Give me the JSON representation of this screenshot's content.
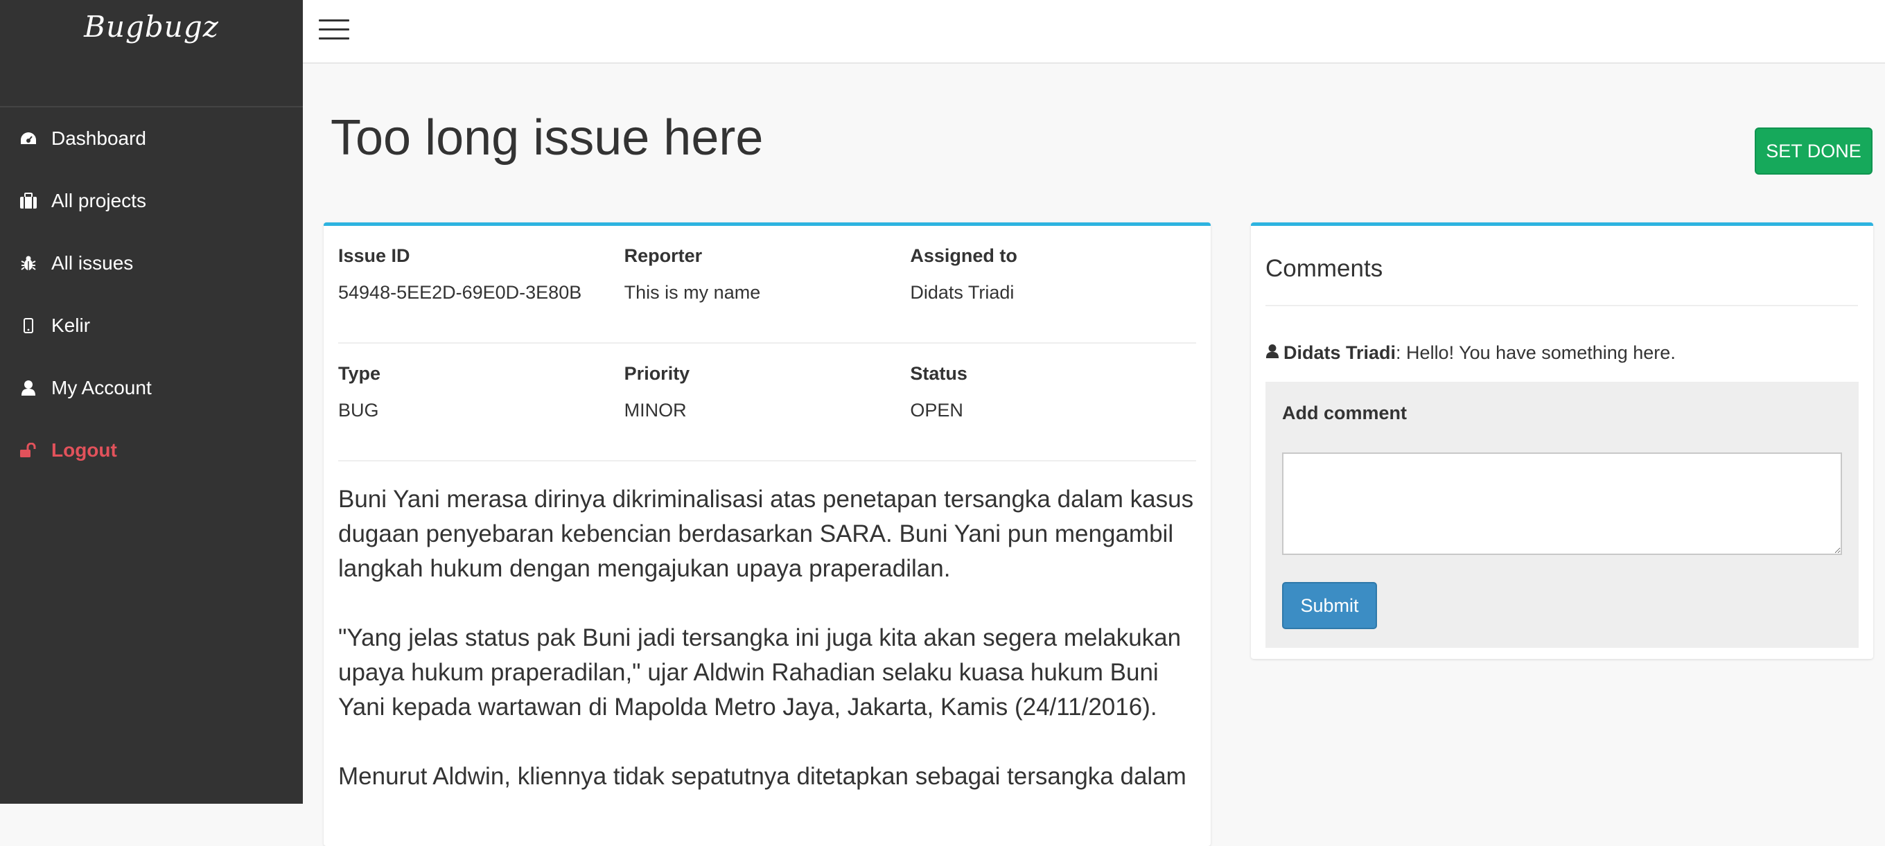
{
  "brand": "Bugbugz",
  "sidebar": {
    "items": [
      {
        "label": "Dashboard",
        "icon": "dashboard-icon"
      },
      {
        "label": "All projects",
        "icon": "briefcase-icon"
      },
      {
        "label": "All issues",
        "icon": "bug-icon"
      },
      {
        "label": "Kelir",
        "icon": "mobile-icon"
      },
      {
        "label": "My Account",
        "icon": "user-icon"
      },
      {
        "label": "Logout",
        "icon": "unlock-icon"
      }
    ]
  },
  "page": {
    "title": "Too long issue here",
    "set_done_label": "SET DONE"
  },
  "issue": {
    "id_label": "Issue ID",
    "id_value": "54948-5EE2D-69E0D-3E80B",
    "reporter_label": "Reporter",
    "reporter_value": "This is my name",
    "assigned_label": "Assigned to",
    "assigned_value": "Didats Triadi",
    "type_label": "Type",
    "type_value": "BUG",
    "priority_label": "Priority",
    "priority_value": "MINOR",
    "status_label": "Status",
    "status_value": "OPEN",
    "description": [
      "Buni Yani merasa dirinya dikriminalisasi atas penetapan tersangka dalam kasus dugaan penyebaran kebencian berdasarkan SARA. Buni Yani pun mengambil langkah hukum dengan mengajukan upaya praperadilan.",
      "\"Yang jelas status pak Buni jadi tersangka ini juga kita akan segera melakukan upaya hukum praperadilan,\" ujar Aldwin Rahadian selaku kuasa hukum Buni Yani kepada wartawan di Mapolda Metro Jaya, Jakarta, Kamis (24/11/2016).",
      "Menurut Aldwin, kliennya tidak sepatutnya ditetapkan sebagai tersangka dalam"
    ]
  },
  "comments": {
    "title": "Comments",
    "items": [
      {
        "author": "Didats Triadi",
        "text": ": Hello! You have something here."
      }
    ],
    "add_label": "Add comment",
    "textarea_value": "",
    "submit_label": "Submit"
  },
  "colors": {
    "sidebar_bg": "#333333",
    "accent": "#2db3e0",
    "done_button": "#16a95b",
    "submit_button": "#3c8dc4",
    "logout": "#e2525b"
  }
}
